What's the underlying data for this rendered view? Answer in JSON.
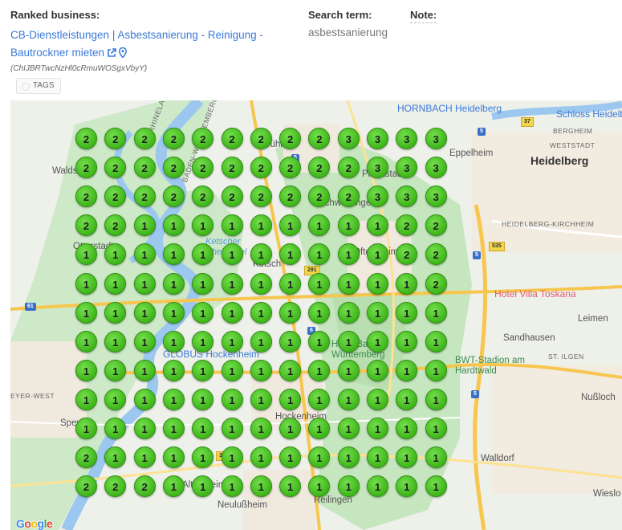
{
  "header": {
    "ranked_label": "Ranked business:",
    "business_name": "CB-Dienstleistungen | Asbestsanierung - Reinigung - Bautrockner mieten",
    "place_id": "(ChIJBRTwcNzHl0cRmuWOSgxVbyY)",
    "search_label": "Search term:",
    "search_term": "asbestsanierung",
    "note_label": "Note:",
    "tags_label": "TAGS",
    "link_color": "#3b7ad9"
  },
  "map": {
    "places": {
      "heidelberg": "Heidelberg",
      "eppelheim": "Eppelheim",
      "bergheim": "BERGHEIM",
      "weststadt": "WESTSTADT",
      "hd_kirchheim": "HEIDELBERG-KIRCHHEIM",
      "leimen": "Leimen",
      "sandhausen": "Sandhausen",
      "st_ilgen": "ST. ILGEN",
      "nussloch": "Nußloch",
      "walldorf": "Walldorf",
      "wiesloch": "Wieslo",
      "hockenheim": "Hockenheim",
      "neulussheim": "Neulußheim",
      "reilingen": "Reilingen",
      "speyer": "Speye",
      "altlussheim": "Altlußheim",
      "otterstadt": "Otterstadt",
      "waldsee": "Walds",
      "ketsch": "Ketsch",
      "oftersheim": "Oftersheim",
      "schwetzingen": "Schwetzingen",
      "plankstadt": "Plankstadt",
      "bruhl": "Brühl",
      "ketscher_rheininsel": "Ketscher Rheininsel",
      "hornbach": "HORNBACH Heidelberg",
      "schloss": "Schloss Heidelbe",
      "villa": "Hotel Villa Toskana",
      "bwt": "BWT-Stadion am Hardtwald",
      "globus": "GLOBUS Hockenheim",
      "hardt": "Hardt Baden-Württemberg",
      "rhineland": "RHINELAND-PALATINATE",
      "baden": "BADEN-WÜRTTEMBERG",
      "speyer_west": "EYER-WEST",
      "google": "Google"
    },
    "roads": [
      "5",
      "37",
      "535",
      "291",
      "6",
      "61",
      "5",
      "5",
      "5",
      "39"
    ],
    "grid_ranks": [
      [
        2,
        2,
        2,
        2,
        2,
        2,
        2,
        2,
        2,
        3,
        3,
        3,
        3
      ],
      [
        2,
        2,
        2,
        2,
        2,
        2,
        2,
        2,
        2,
        2,
        3,
        3,
        3
      ],
      [
        2,
        2,
        2,
        2,
        2,
        2,
        2,
        2,
        2,
        2,
        3,
        3,
        3
      ],
      [
        2,
        2,
        1,
        1,
        1,
        1,
        1,
        1,
        1,
        1,
        1,
        2,
        2
      ],
      [
        1,
        1,
        1,
        1,
        1,
        1,
        1,
        1,
        1,
        1,
        1,
        2,
        2
      ],
      [
        1,
        1,
        1,
        1,
        1,
        1,
        1,
        1,
        1,
        1,
        1,
        1,
        2
      ],
      [
        1,
        1,
        1,
        1,
        1,
        1,
        1,
        1,
        1,
        1,
        1,
        1,
        1
      ],
      [
        1,
        1,
        1,
        1,
        1,
        1,
        1,
        1,
        1,
        1,
        1,
        1,
        1
      ],
      [
        1,
        1,
        1,
        1,
        1,
        1,
        1,
        1,
        1,
        1,
        1,
        1,
        1
      ],
      [
        1,
        1,
        1,
        1,
        1,
        1,
        1,
        1,
        1,
        1,
        1,
        1,
        1
      ],
      [
        1,
        1,
        1,
        1,
        1,
        1,
        1,
        1,
        1,
        1,
        1,
        1,
        1
      ],
      [
        2,
        1,
        1,
        1,
        1,
        1,
        1,
        1,
        1,
        1,
        1,
        1,
        1
      ],
      [
        2,
        2,
        2,
        1,
        1,
        1,
        1,
        1,
        1,
        1,
        1,
        1,
        1
      ]
    ],
    "pin_color": "#4cc522"
  }
}
